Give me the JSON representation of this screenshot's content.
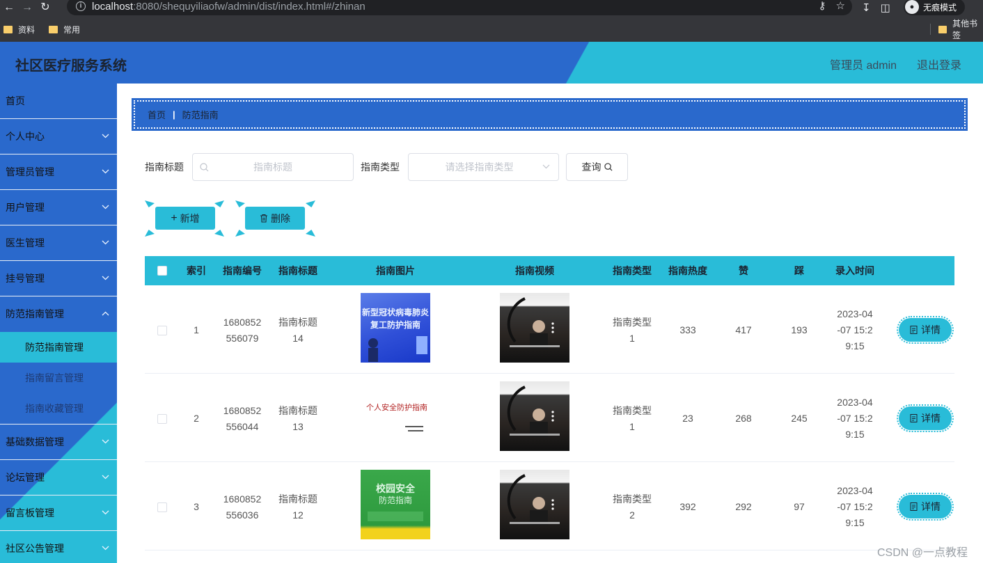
{
  "browser": {
    "url_host": "localhost",
    "url_rest": ":8080/shequyiliaofw/admin/dist/index.html#/zhinan",
    "incognito_label": "无痕模式",
    "bookmarks": [
      "资料",
      "常用"
    ],
    "other_bookmarks": "其他书签"
  },
  "header": {
    "title": "社区医疗服务系统",
    "user": "管理员 admin",
    "logout": "退出登录"
  },
  "sidebar": {
    "items": [
      {
        "label": "首页"
      },
      {
        "label": "个人中心"
      },
      {
        "label": "管理员管理"
      },
      {
        "label": "用户管理"
      },
      {
        "label": "医生管理"
      },
      {
        "label": "挂号管理"
      },
      {
        "label": "防范指南管理"
      },
      {
        "label": "基础数据管理"
      },
      {
        "label": "论坛管理"
      },
      {
        "label": "留言板管理"
      },
      {
        "label": "社区公告管理"
      }
    ],
    "sub_items": [
      {
        "label": "防范指南管理"
      },
      {
        "label": "指南留言管理"
      },
      {
        "label": "指南收藏管理"
      }
    ]
  },
  "breadcrumb": {
    "home": "首页",
    "sep": "|",
    "current": "防范指南"
  },
  "search": {
    "title_label": "指南标题",
    "title_placeholder": "指南标题",
    "type_label": "指南类型",
    "type_placeholder": "请选择指南类型",
    "query_label": "查询"
  },
  "actions": {
    "add_label": "新增",
    "delete_label": "删除"
  },
  "table": {
    "headers": [
      "索引",
      "指南编号",
      "指南标题",
      "指南图片",
      "指南视频",
      "指南类型",
      "指南热度",
      "赞",
      "踩",
      "录入时间"
    ],
    "detail_label": "详情",
    "rows": [
      {
        "index": "1",
        "code_a": "1680852",
        "code_b": "556079",
        "title_a": "指南标题",
        "title_b": "14",
        "type_a": "指南类型",
        "type_b": "1",
        "heat": "333",
        "likes": "417",
        "dislikes": "193",
        "time_a": "2023-04",
        "time_b": "-07 15:2",
        "time_c": "9:15",
        "image_text": "新型冠状病毒肺炎 复工防护指南"
      },
      {
        "index": "2",
        "code_a": "1680852",
        "code_b": "556044",
        "title_a": "指南标题",
        "title_b": "13",
        "type_a": "指南类型",
        "type_b": "1",
        "heat": "23",
        "likes": "268",
        "dislikes": "245",
        "time_a": "2023-04",
        "time_b": "-07 15:2",
        "time_c": "9:15",
        "image_text": "个人安全防护指南"
      },
      {
        "index": "3",
        "code_a": "1680852",
        "code_b": "556036",
        "title_a": "指南标题",
        "title_b": "12",
        "type_a": "指南类型",
        "type_b": "2",
        "heat": "392",
        "likes": "292",
        "dislikes": "97",
        "time_a": "2023-04",
        "time_b": "-07 15:2",
        "time_c": "9:15",
        "image_text": "校园安全 防范指南"
      }
    ]
  },
  "colors": {
    "primary": "#2a69cc",
    "accent": "#29bcd8"
  },
  "watermark": "CSDN @一点教程"
}
